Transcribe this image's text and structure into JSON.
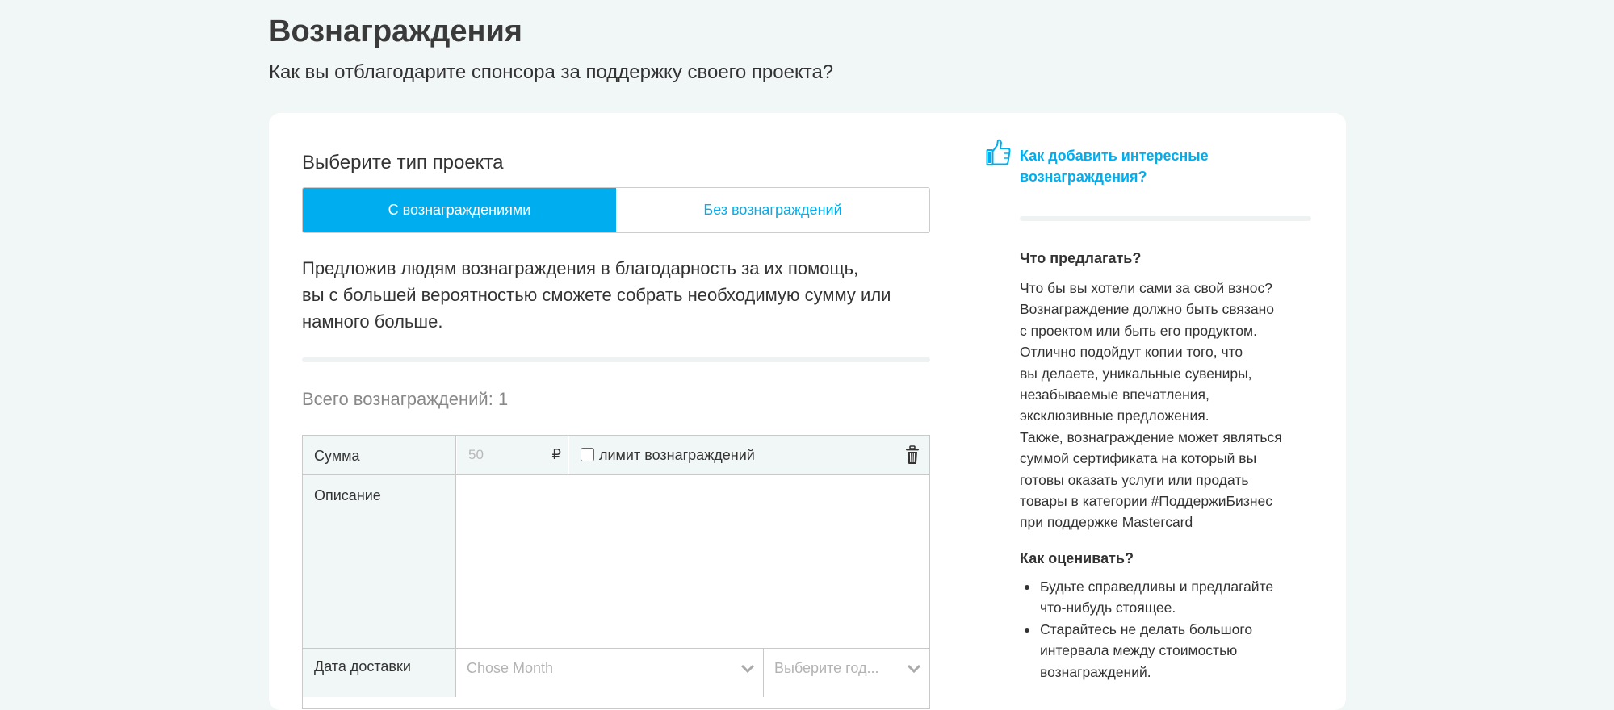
{
  "page": {
    "title": "Вознаграждения",
    "subtitle": "Как вы отблагодарите спонсора за поддержку своего проекта?"
  },
  "project_type": {
    "heading": "Выберите тип проекта",
    "options": [
      {
        "label": "С вознаграждениями",
        "selected": true
      },
      {
        "label": "Без вознаграждений",
        "selected": false
      }
    ],
    "intro_lines": [
      "Предложив людям вознаграждения в благодарность за их помощь,",
      "вы с большей вероятностью сможете собрать необходимую сумму или",
      "намного больше."
    ]
  },
  "rewards": {
    "total_label": "Всего вознаграждений:",
    "total_value": "1",
    "form": {
      "sum_label": "Сумма",
      "sum_placeholder": "50",
      "currency": "₽",
      "limit_label": "лимит вознаграждений",
      "limit_checked": false,
      "description_label": "Описание",
      "delivery_label": "Дата доставки",
      "month_placeholder": "Chose Month",
      "year_placeholder": "Выберите год..."
    }
  },
  "tips": {
    "link": "Как добавить интересные вознаграждения?",
    "what_heading": "Что предлагать?",
    "what_lines": [
      "Что бы вы хотели сами за свой взнос?",
      "Вознаграждение должно быть связано",
      "с проектом или быть его продуктом.",
      "Отлично подойдут копии того, что",
      "вы делаете, уникальные сувениры,",
      "незабываемые впечатления,",
      "эксклюзивные предложения.",
      "Также, вознаграждение может являться",
      "суммой сертификата на который вы",
      "готовы оказать услуги или продать",
      "товары в категории #ПоддержиБизнес",
      "при поддержке Mastercard"
    ],
    "how_heading": "Как оценивать?",
    "how_items": [
      [
        "Будьте справедливы и предлагайте",
        "что-нибудь стоящее."
      ],
      [
        "Старайтесь не делать большого",
        "интервала между стоимостью",
        "вознаграждений."
      ]
    ]
  },
  "colors": {
    "accent": "#00aeef",
    "background": "#f1f6f6",
    "card": "#ffffff"
  },
  "icons": {
    "tip": "thumbs-up-icon",
    "delete": "trash-icon",
    "dropdown": "chevron-down-icon"
  }
}
